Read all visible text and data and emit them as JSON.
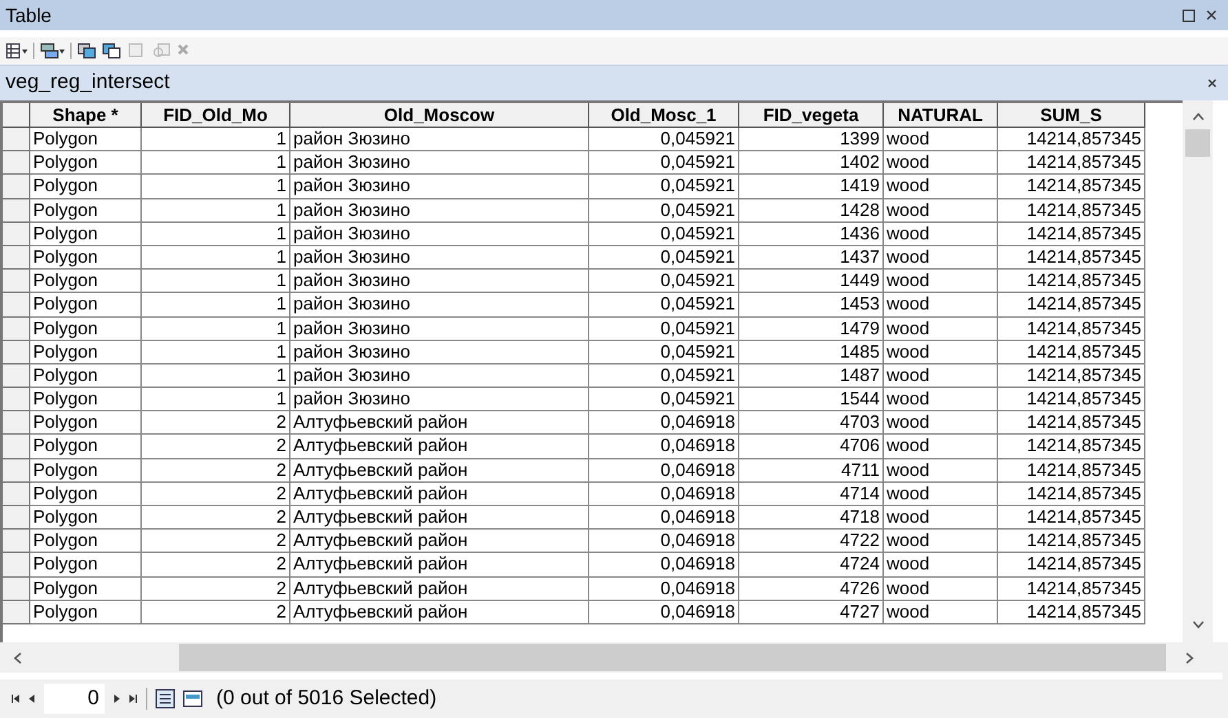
{
  "window": {
    "title": "Table"
  },
  "table_name": "veg_reg_intersect",
  "table": {
    "columns": [
      "Shape *",
      "FID_Old_Mo",
      "Old_Moscow",
      "Old_Mosc_1",
      "FID_vegeta",
      "NATURAL",
      "SUM_S"
    ],
    "rows": [
      [
        "Polygon",
        "1",
        "район Зюзино",
        "0,045921",
        "1399",
        "wood",
        "14214,857345"
      ],
      [
        "Polygon",
        "1",
        "район Зюзино",
        "0,045921",
        "1402",
        "wood",
        "14214,857345"
      ],
      [
        "Polygon",
        "1",
        "район Зюзино",
        "0,045921",
        "1419",
        "wood",
        "14214,857345"
      ],
      [
        "Polygon",
        "1",
        "район Зюзино",
        "0,045921",
        "1428",
        "wood",
        "14214,857345"
      ],
      [
        "Polygon",
        "1",
        "район Зюзино",
        "0,045921",
        "1436",
        "wood",
        "14214,857345"
      ],
      [
        "Polygon",
        "1",
        "район Зюзино",
        "0,045921",
        "1437",
        "wood",
        "14214,857345"
      ],
      [
        "Polygon",
        "1",
        "район Зюзино",
        "0,045921",
        "1449",
        "wood",
        "14214,857345"
      ],
      [
        "Polygon",
        "1",
        "район Зюзино",
        "0,045921",
        "1453",
        "wood",
        "14214,857345"
      ],
      [
        "Polygon",
        "1",
        "район Зюзино",
        "0,045921",
        "1479",
        "wood",
        "14214,857345"
      ],
      [
        "Polygon",
        "1",
        "район Зюзино",
        "0,045921",
        "1485",
        "wood",
        "14214,857345"
      ],
      [
        "Polygon",
        "1",
        "район Зюзино",
        "0,045921",
        "1487",
        "wood",
        "14214,857345"
      ],
      [
        "Polygon",
        "1",
        "район Зюзино",
        "0,045921",
        "1544",
        "wood",
        "14214,857345"
      ],
      [
        "Polygon",
        "2",
        "Алтуфьевский район",
        "0,046918",
        "4703",
        "wood",
        "14214,857345"
      ],
      [
        "Polygon",
        "2",
        "Алтуфьевский район",
        "0,046918",
        "4706",
        "wood",
        "14214,857345"
      ],
      [
        "Polygon",
        "2",
        "Алтуфьевский район",
        "0,046918",
        "4711",
        "wood",
        "14214,857345"
      ],
      [
        "Polygon",
        "2",
        "Алтуфьевский район",
        "0,046918",
        "4714",
        "wood",
        "14214,857345"
      ],
      [
        "Polygon",
        "2",
        "Алтуфьевский район",
        "0,046918",
        "4718",
        "wood",
        "14214,857345"
      ],
      [
        "Polygon",
        "2",
        "Алтуфьевский район",
        "0,046918",
        "4722",
        "wood",
        "14214,857345"
      ],
      [
        "Polygon",
        "2",
        "Алтуфьевский район",
        "0,046918",
        "4724",
        "wood",
        "14214,857345"
      ],
      [
        "Polygon",
        "2",
        "Алтуфьевский район",
        "0,046918",
        "4726",
        "wood",
        "14214,857345"
      ],
      [
        "Polygon",
        "2",
        "Алтуфьевский район",
        "0,046918",
        "4727",
        "wood",
        "14214,857345"
      ]
    ]
  },
  "footer": {
    "record": "0",
    "status": "(0 out of 5016 Selected)"
  }
}
